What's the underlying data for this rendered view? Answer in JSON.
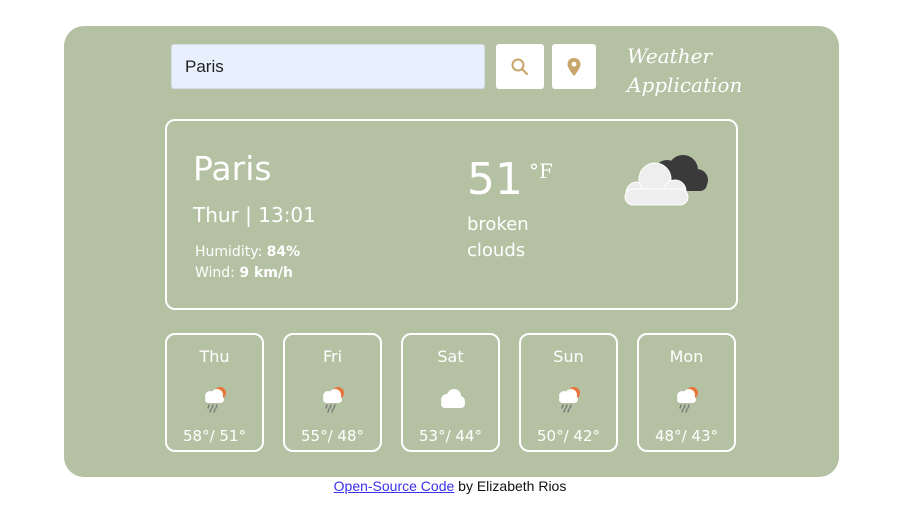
{
  "search": {
    "value": "Paris",
    "search_button_icon": "search-icon",
    "location_button_icon": "map-pin-icon"
  },
  "app_title": "Weather Application",
  "current": {
    "city": "Paris",
    "datetime": "Thur | 13:01",
    "humidity_label": "Humidity:",
    "humidity_value": "84%",
    "wind_label": "Wind:",
    "wind_value": "9 km/h",
    "temperature": "51",
    "unit": "°F",
    "condition_line1": "broken",
    "condition_line2": "clouds",
    "icon": "broken-clouds-icon"
  },
  "forecast": [
    {
      "day": "Thu",
      "temps": "58°/ 51°",
      "icon": "rain-sun-icon"
    },
    {
      "day": "Fri",
      "temps": "55°/ 48°",
      "icon": "rain-sun-icon"
    },
    {
      "day": "Sat",
      "temps": "53°/ 44°",
      "icon": "cloud-icon"
    },
    {
      "day": "Sun",
      "temps": "50°/ 42°",
      "icon": "rain-sun-icon"
    },
    {
      "day": "Mon",
      "temps": "48°/ 43°",
      "icon": "rain-sun-icon"
    }
  ],
  "footer": {
    "link_text": "Open-Source Code",
    "suffix": " by Elizabeth Rios"
  },
  "colors": {
    "background": "#b4c1a3",
    "accent": "#c9a66b",
    "input_bg": "#e8f0fe",
    "link": "#3b2ff0"
  }
}
